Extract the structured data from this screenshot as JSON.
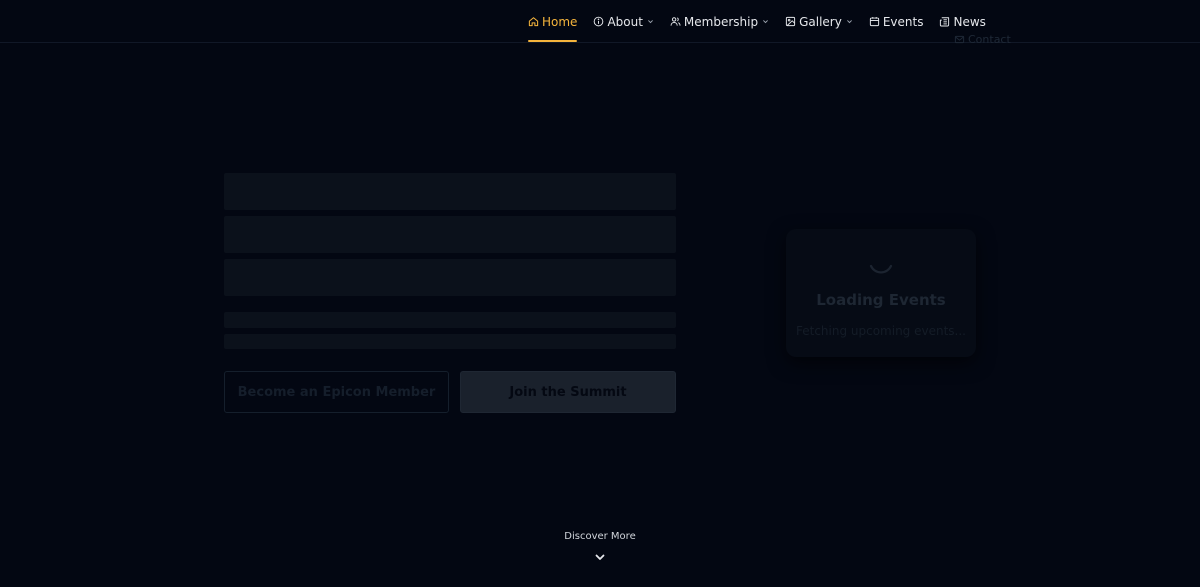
{
  "nav": {
    "home": "Home",
    "about": "About",
    "membership": "Membership",
    "gallery": "Gallery",
    "events": "Events",
    "news": "News",
    "contact": "Contact",
    "active": "home"
  },
  "hero": {
    "member_button": "Become an Epicon Member",
    "summit_button": "Join the Summit"
  },
  "events_card": {
    "title": "Loading Events",
    "subtitle": "Fetching upcoming events..."
  },
  "discover": {
    "label": "Discover More"
  },
  "colors": {
    "background": "#030712",
    "accent": "#f5b43c",
    "nav_text": "#e5e7eb"
  },
  "icons": {
    "home": "home-icon",
    "about": "info-icon",
    "membership": "users-icon",
    "gallery": "image-icon",
    "events": "calendar-icon",
    "news": "newspaper-icon",
    "contact": "mail-icon",
    "discover": "chevron-down-icon"
  }
}
